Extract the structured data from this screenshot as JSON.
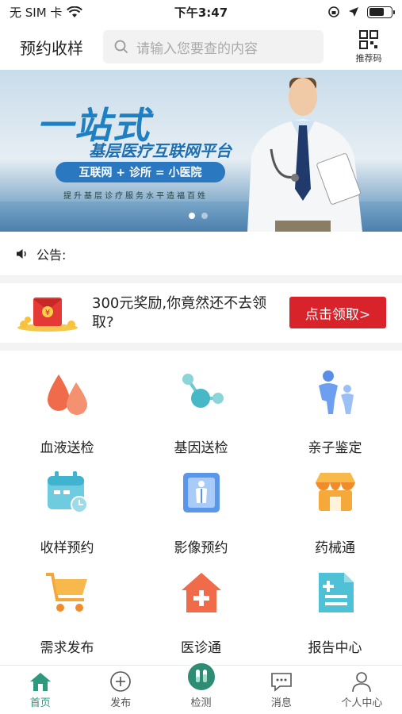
{
  "status_bar": {
    "carrier": "无 SIM 卡",
    "time": "下午3:47"
  },
  "header": {
    "title": "预约收样",
    "search_placeholder": "请输入您要查的内容",
    "qr_label": "推荐码"
  },
  "banner": {
    "headline": "一站式",
    "subtitle": "基层医疗互联网平台",
    "pill": "互联网 + 诊所 = 小医院",
    "slogan": "提升基层诊疗服务水平造福百姓",
    "slides": 2,
    "active_slide": 1
  },
  "notice": {
    "label": "公告:"
  },
  "promo": {
    "text": "300元奖励,你竟然还不去领取?",
    "button": "点击领取>"
  },
  "services": [
    {
      "label": "血液送检",
      "icon": "blood-drop-icon"
    },
    {
      "label": "基因送检",
      "icon": "molecule-icon"
    },
    {
      "label": "亲子鉴定",
      "icon": "parent-child-icon"
    },
    {
      "label": "收样预约",
      "icon": "calendar-icon"
    },
    {
      "label": "影像预约",
      "icon": "xray-icon"
    },
    {
      "label": "药械通",
      "icon": "shop-icon"
    },
    {
      "label": "需求发布",
      "icon": "cart-icon"
    },
    {
      "label": "医诊通",
      "icon": "clinic-icon"
    },
    {
      "label": "报告中心",
      "icon": "report-icon"
    }
  ],
  "tabs": [
    {
      "label": "首页",
      "active": true
    },
    {
      "label": "发布"
    },
    {
      "label": "检测"
    },
    {
      "label": "消息"
    },
    {
      "label": "个人中心"
    }
  ],
  "colors": {
    "accent": "#2d9a7e",
    "promo_button": "#d9232b"
  }
}
